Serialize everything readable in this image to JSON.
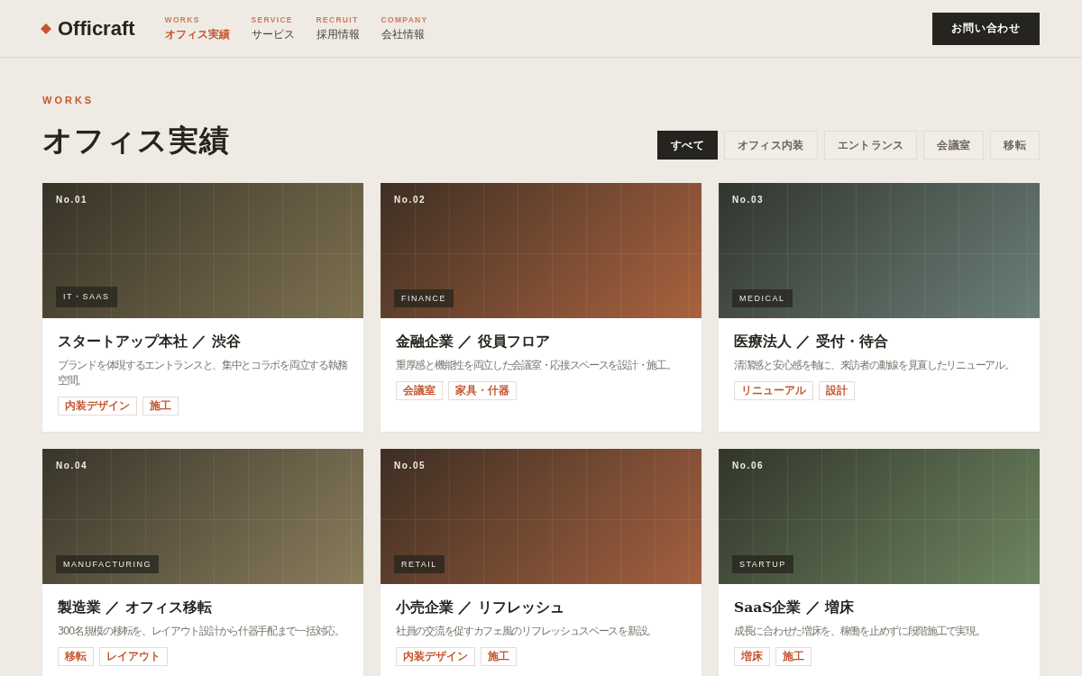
{
  "header": {
    "logo": "Officraft",
    "nav": [
      {
        "label": "WORKS",
        "text": "オフィス実績",
        "selected": true
      },
      {
        "label": "SERVICE",
        "text": "サービス",
        "selected": false
      },
      {
        "label": "RECRUIT",
        "text": "採用情報",
        "selected": false
      },
      {
        "label": "COMPANY",
        "text": "会社情報",
        "selected": false
      }
    ],
    "contact_button": "お問い合わせ"
  },
  "section": {
    "eyebrow": "WORKS",
    "title": "オフィス実績",
    "filters": [
      {
        "label": "すべて",
        "selected": true
      },
      {
        "label": "オフィス内装",
        "selected": false
      },
      {
        "label": "エントランス",
        "selected": false
      },
      {
        "label": "会議室",
        "selected": false
      },
      {
        "label": "移転",
        "selected": false
      }
    ]
  },
  "works": [
    {
      "number": "No.01",
      "category": "IT・SAAS",
      "color": "#7e7151",
      "title": "スタートアップ本社 ／ 渋谷",
      "description": "ブランドを体現するエントランスと、集中とコラボを両立する執務空間。",
      "tags": [
        "内装デザイン",
        "施工"
      ]
    },
    {
      "number": "No.02",
      "category": "FINANCE",
      "color": "#a9623f",
      "title": "金融企業 ／ 役員フロア",
      "description": "重厚感と機能性を両立した会議室・応接スペースを設計・施工。",
      "tags": [
        "会議室",
        "家具・什器"
      ]
    },
    {
      "number": "No.03",
      "category": "MEDICAL",
      "color": "#6a7f77",
      "title": "医療法人 ／ 受付・待合",
      "description": "清潔感と安心感を軸に、来訪者の動線を見直したリニューアル。",
      "tags": [
        "リニューアル",
        "設計"
      ]
    },
    {
      "number": "No.04",
      "category": "MANUFACTURING",
      "color": "#8a7d5d",
      "title": "製造業 ／ オフィス移転",
      "description": "300名規模の移転を、レイアウト設計から什器手配まで一括対応。",
      "tags": [
        "移転",
        "レイアウト"
      ]
    },
    {
      "number": "No.05",
      "category": "RETAIL",
      "color": "#a3603f",
      "title": "小売企業 ／ リフレッシュ",
      "description": "社員の交流を促すカフェ風のリフレッシュスペースを新設。",
      "tags": [
        "内装デザイン",
        "施工"
      ]
    },
    {
      "number": "No.06",
      "category": "STARTUP",
      "color": "#6d8561",
      "title": "SaaS企業 ／ 増床",
      "description": "成長に合わせた増床を、稼働を止めずに段階施工で実現。",
      "tags": [
        "増床",
        "施工"
      ]
    }
  ]
}
